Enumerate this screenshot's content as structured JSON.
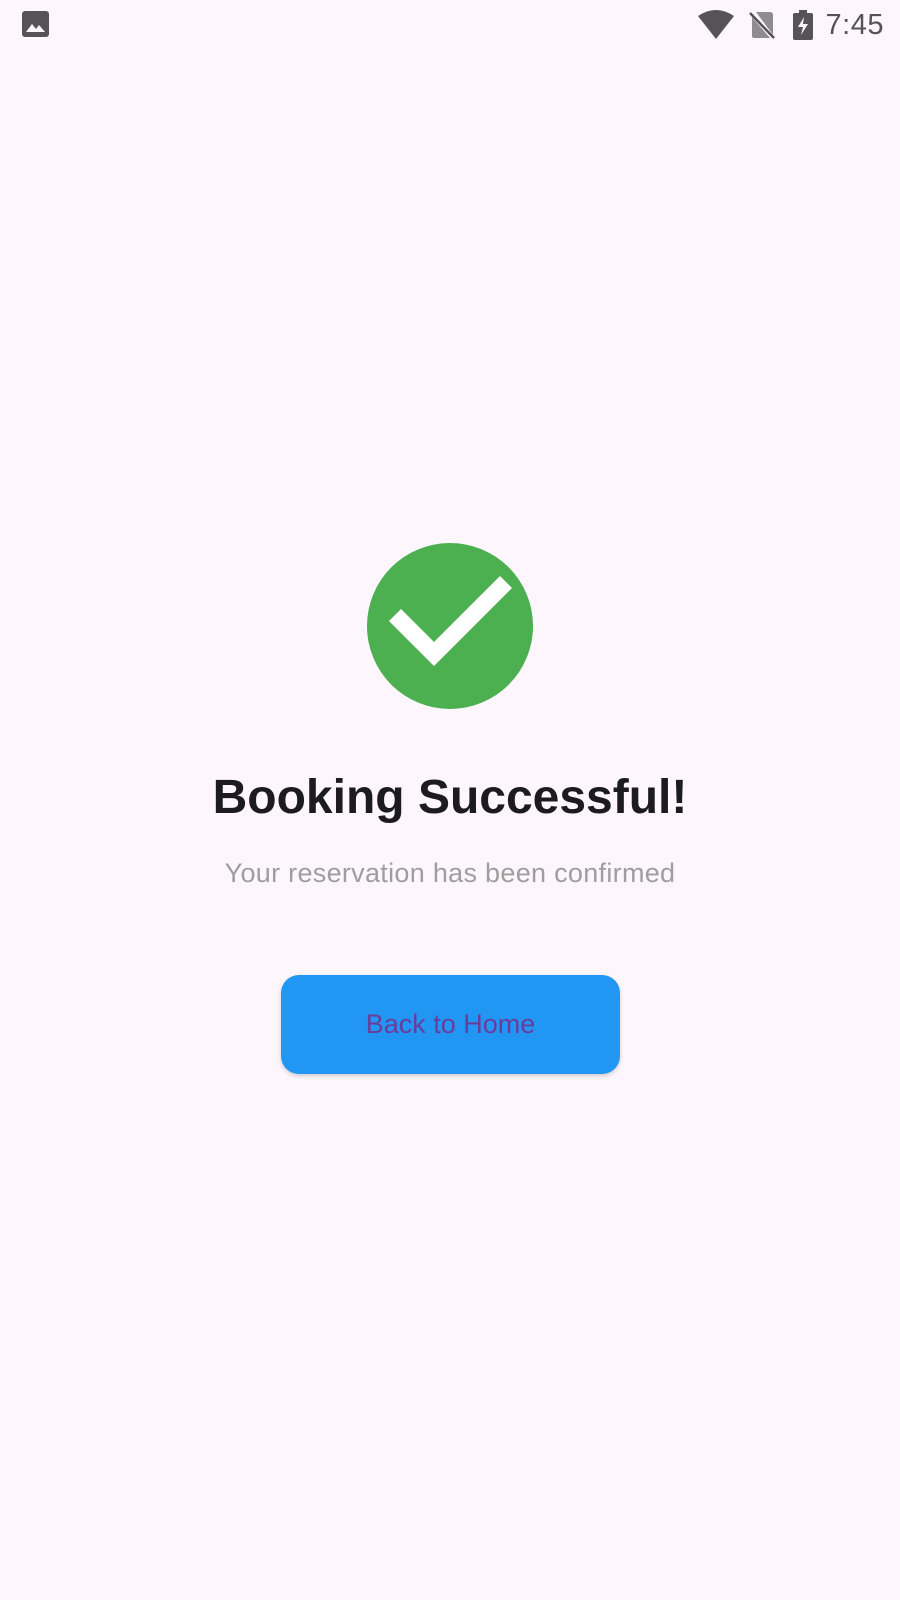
{
  "status_bar": {
    "time": "7:45",
    "left_icon": "image-icon",
    "right_icons": [
      "wifi-icon",
      "no-sim-icon",
      "battery-charging-icon"
    ],
    "icon_color": "#555355"
  },
  "confirmation": {
    "icon": "check-circle-icon",
    "icon_color": "#4caf50",
    "title": "Booking Successful!",
    "subtitle": "Your reservation has been confirmed"
  },
  "actions": {
    "home_button_label": "Back to Home",
    "home_button_color": "#2196f3",
    "home_button_text_color": "#6a3d9a"
  },
  "colors": {
    "background": "#fdf6fd",
    "title": "#1c1b1f",
    "subtitle": "#9e9e9e"
  }
}
